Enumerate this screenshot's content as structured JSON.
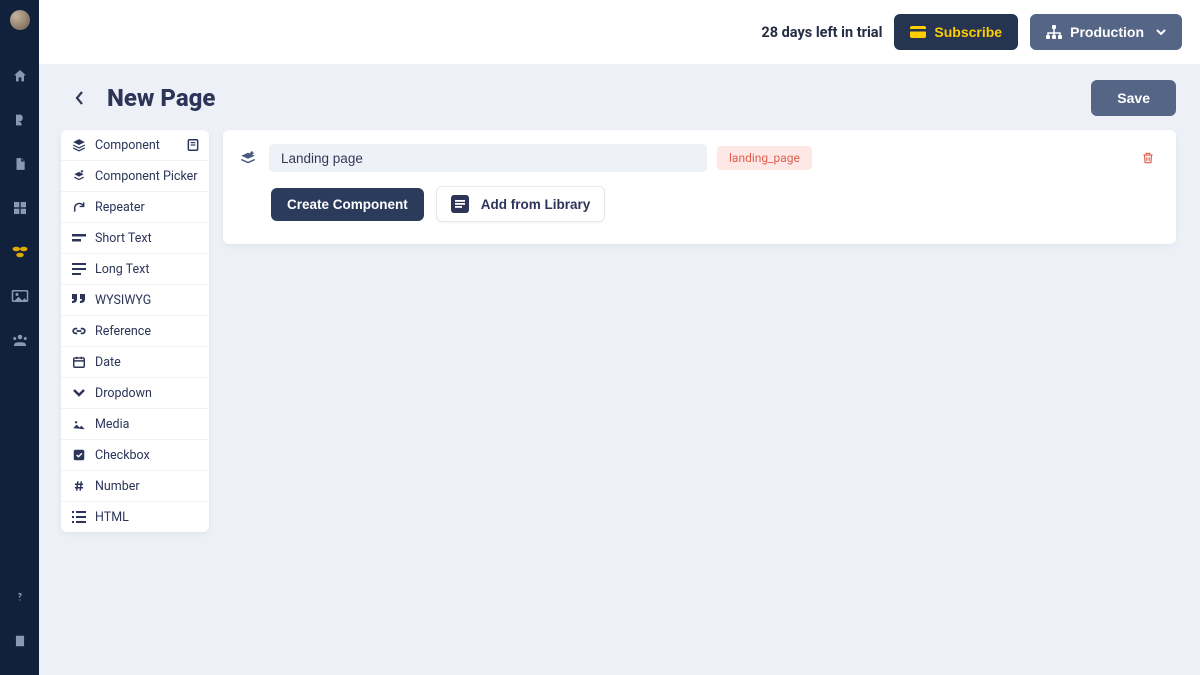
{
  "header": {
    "trial_text": "28 days left in trial",
    "subscribe_label": "Subscribe",
    "environment_label": "Production"
  },
  "page": {
    "title": "New Page",
    "save_label": "Save",
    "component_title": "Landing page",
    "component_slug": "landing_page",
    "create_component_label": "Create Component",
    "add_from_library_label": "Add from Library"
  },
  "fields": {
    "items": [
      {
        "label": "Component"
      },
      {
        "label": "Component Picker"
      },
      {
        "label": "Repeater"
      },
      {
        "label": "Short Text"
      },
      {
        "label": "Long Text"
      },
      {
        "label": "WYSIWYG"
      },
      {
        "label": "Reference"
      },
      {
        "label": "Date"
      },
      {
        "label": "Dropdown"
      },
      {
        "label": "Media"
      },
      {
        "label": "Checkbox"
      },
      {
        "label": "Number"
      },
      {
        "label": "HTML"
      }
    ]
  }
}
